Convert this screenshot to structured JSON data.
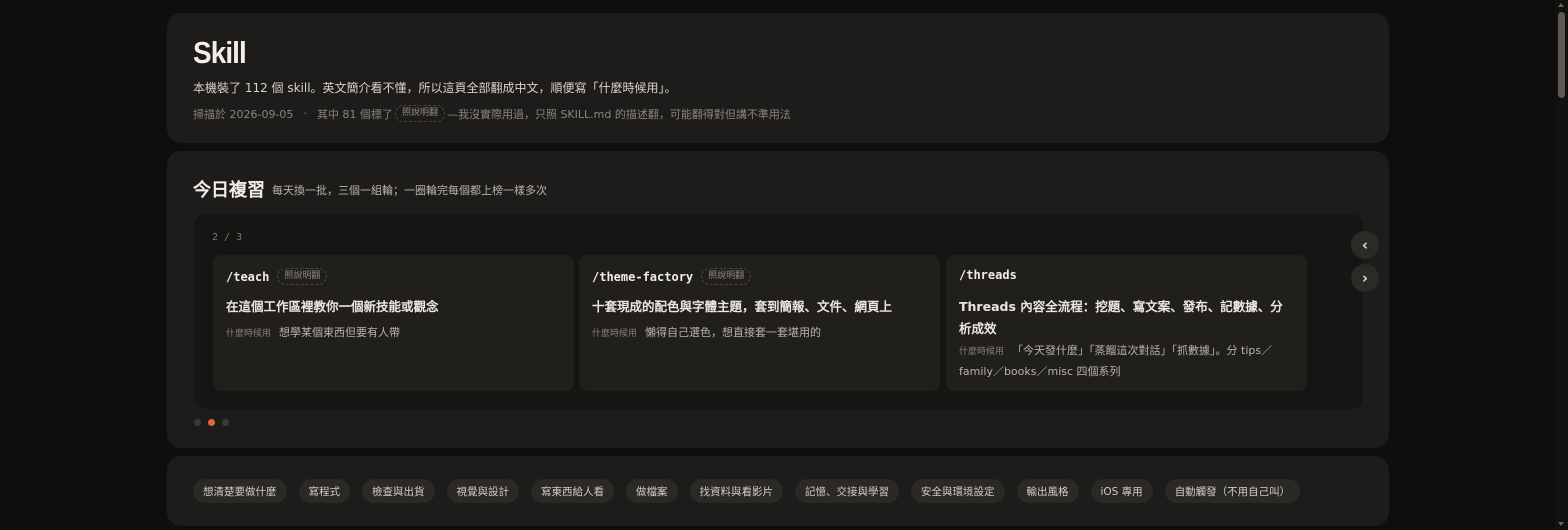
{
  "header": {
    "title": "Skill",
    "description": "本機裝了 112 個 skill。英文簡介看不懂，所以這頁全部翻成中文，順便寫「什麼時候用」。",
    "scanned": "掃描於 2026-09-05",
    "separator": "·",
    "note_prefix": "其中 81 個標了",
    "note_tag": "照說明翻",
    "note_suffix": "—我沒實際用過，只照 SKILL.md 的描述翻，可能翻得對但講不準用法"
  },
  "review": {
    "title": "今日複習",
    "subtitle": "每天換一批，三個一組輪；一圈輪完每個都上榜一樣多次",
    "page_counter": "2 / 3",
    "prev_label": "‹",
    "next_label": "›",
    "when_label": "什麼時候用",
    "cards": [
      {
        "command": "/teach",
        "tag": "照說明翻",
        "title": "在這個工作區裡教你一個新技能或觀念",
        "when": "想學某個東西但要有人帶"
      },
      {
        "command": "/theme-factory",
        "tag": "照說明翻",
        "title": "十套現成的配色與字體主題，套到簡報、文件、網頁上",
        "when": "懶得自己選色，想直接套一套堪用的"
      },
      {
        "command": "/threads",
        "tag": "",
        "title": "Threads 內容全流程：挖題、寫文案、發布、記數據、分析成效",
        "when": "「今天發什麼」「蒸餾這次對話」「抓數據」。分 tips／family／books／misc 四個系列"
      }
    ],
    "dots_total": 3,
    "dots_active": 2
  },
  "categories": [
    "想清楚要做什麼",
    "寫程式",
    "檢查與出貨",
    "視覺與設計",
    "寫東西給人看",
    "做檔案",
    "找資料與看影片",
    "記憶、交接與學習",
    "安全與環境設定",
    "輸出風格",
    "iOS 專用",
    "自動觸發（不用自己叫）"
  ],
  "colors": {
    "background": "#0f0e0d",
    "panel": "#1d1c1a",
    "accent": "#e2683c"
  }
}
